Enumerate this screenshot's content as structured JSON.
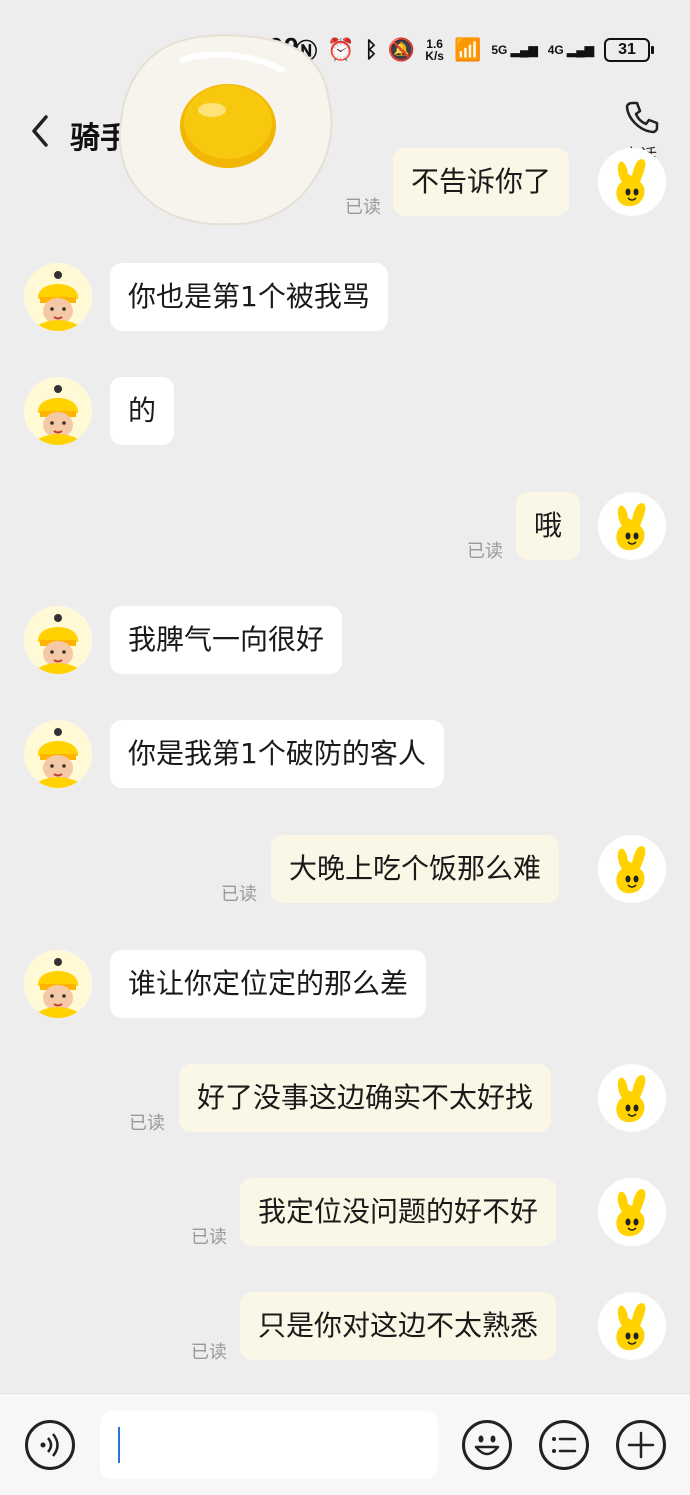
{
  "status_bar": {
    "time": "22:09",
    "net_speed_top": "1.6",
    "net_speed_unit": "K/s",
    "sim1": "5G",
    "sim2": "4G",
    "battery": "31"
  },
  "header": {
    "title": "骑手",
    "call_label": "电话"
  },
  "messages": [
    {
      "from": "me",
      "text": "不告诉你了",
      "read": "已读"
    },
    {
      "from": "rider",
      "text": "你也是第1个被我骂"
    },
    {
      "from": "rider",
      "text": "的"
    },
    {
      "from": "me",
      "text": "哦",
      "read": "已读"
    },
    {
      "from": "rider",
      "text": "我脾气一向很好"
    },
    {
      "from": "rider",
      "text": "你是我第1个破防的客人"
    },
    {
      "from": "me",
      "text": "大晚上吃个饭那么难",
      "read": "已读"
    },
    {
      "from": "rider",
      "text": "谁让你定位定的那么差"
    },
    {
      "from": "me",
      "text": "好了没事这边确实不太好找",
      "read": "已读"
    },
    {
      "from": "me",
      "text": "我定位没问题的好不好",
      "read": "已读"
    },
    {
      "from": "me",
      "text": "只是你对这边不太熟悉",
      "read": "已读"
    }
  ],
  "input": {
    "value": ""
  },
  "icons": {
    "back": "chevron-left-icon",
    "call": "phone-icon",
    "voice": "voice-icon",
    "emoji": "emoji-icon",
    "quick_reply": "list-icon",
    "more": "plus-icon"
  },
  "colors": {
    "background": "#ededed",
    "rider_bubble": "#ffffff",
    "my_bubble": "#fbf7e6",
    "avatar_yellow": "#ffd200",
    "read_text": "#999999"
  }
}
